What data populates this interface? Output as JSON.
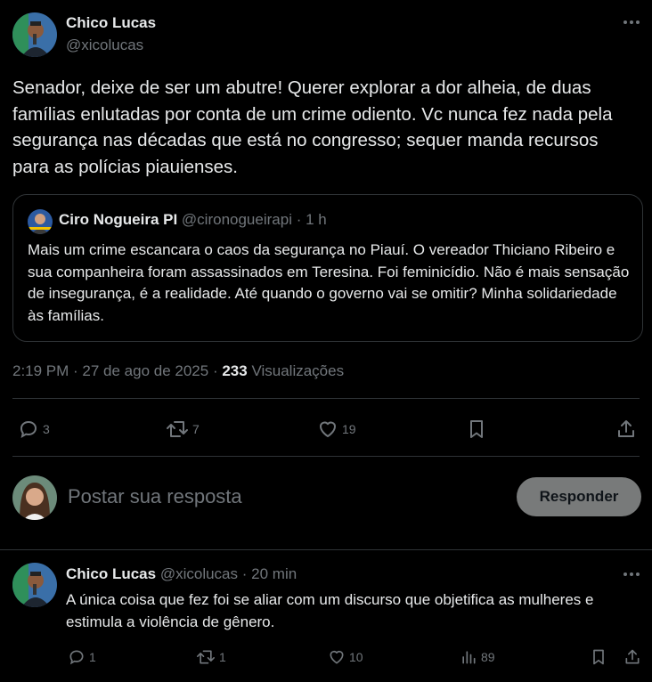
{
  "main_tweet": {
    "author_name": "Chico Lucas",
    "author_handle": "@xicolucas",
    "text": "Senador, deixe de ser um abutre! Querer explorar a dor alheia, de duas famílias enlutadas por conta de um crime odiento. Vc nunca fez nada pela segurança nas décadas que está no congresso; sequer manda recursos para as polícias piauienses.",
    "quoted": {
      "author_name": "Ciro Nogueira PI",
      "author_handle": "@cironogueirapi",
      "separator": "·",
      "time": "1 h",
      "text": "Mais um crime escancara o caos da segurança no Piauí. O vereador Thiciano Ribeiro e sua companheira foram assassinados em Teresina. Foi feminicídio. Não é mais sensação de insegurança, é a realidade. Até quando o governo vai se omitir? Minha solidariedade às famílias."
    },
    "timestamp": "2:19 PM · 27 de ago de 2025 ·",
    "views_count": "233",
    "views_label": "Visualizações",
    "replies": "3",
    "retweets": "7",
    "likes": "19"
  },
  "reply_box": {
    "placeholder": "Postar sua resposta",
    "button_label": "Responder"
  },
  "reply_tweet": {
    "author_name": "Chico Lucas",
    "author_handle": "@xicolucas",
    "separator": "·",
    "time": "20 min",
    "text": "A única coisa que fez foi se aliar com um discurso que objetifica as mulheres e estimula a violência de gênero.",
    "replies": "1",
    "retweets": "1",
    "likes": "10",
    "views": "89"
  },
  "colors": {
    "background": "#000000",
    "text": "#e7e9ea",
    "muted": "#71767b",
    "border": "#2f3336",
    "button_bg": "#787a7a"
  }
}
